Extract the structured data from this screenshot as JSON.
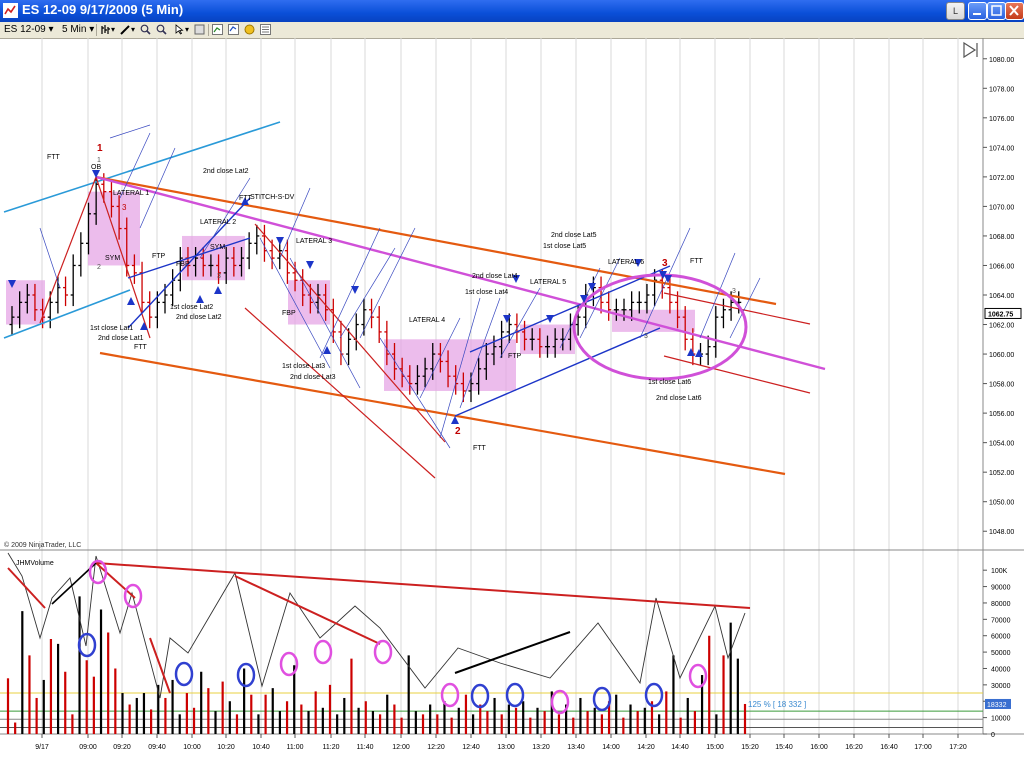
{
  "window": {
    "title": "ES 12-09  9/17/2009 (5 Min)",
    "minimize_label": "L"
  },
  "toolbar": {
    "instrument": "ES 12-09",
    "interval": "5 Min"
  },
  "copyright": "© 2009 NinjaTrader, LLC",
  "colors": {
    "up_bar": "#000000",
    "down_bar": "#cc0000",
    "lateral_box": "#e6a6e6",
    "channel_red": "#cc2020",
    "channel_orange": "#e45a10",
    "trend_blue": "#1c35c8",
    "cyan_line": "#2a9ad8",
    "magenta_line": "#d050d8"
  },
  "chart_data": [
    {
      "type": "bar",
      "panel": "price",
      "title": "",
      "ylim": [
        1047,
        1081
      ],
      "y_ticks": [
        "1080.00",
        "1078.00",
        "1076.00",
        "1074.00",
        "1072.00",
        "1070.00",
        "1068.00",
        "1066.00",
        "1064.00",
        "1062.00",
        "1060.00",
        "1058.00",
        "1056.00",
        "1054.00",
        "1052.00",
        "1050.00",
        "1048.00"
      ],
      "last_price": "1062.75",
      "x_ticks": [
        "9/17",
        "09:00",
        "09:20",
        "09:40",
        "10:00",
        "10:20",
        "10:40",
        "11:00",
        "11:20",
        "11:40",
        "12:00",
        "12:20",
        "12:40",
        "13:00",
        "13:20",
        "13:40",
        "14:00",
        "14:20",
        "14:40",
        "15:00",
        "15:20",
        "15:40",
        "16:00",
        "16:20",
        "16:40",
        "17:00",
        "17:20"
      ],
      "close_series": [
        1062.5,
        1063.5,
        1064,
        1063,
        1062.5,
        1063.5,
        1064.5,
        1064,
        1066,
        1067.5,
        1069.5,
        1071.5,
        1071,
        1070,
        1068.5,
        1066,
        1065.5,
        1063.5,
        1062.5,
        1063.5,
        1064,
        1065,
        1066.5,
        1066,
        1066.5,
        1066,
        1066,
        1065.5,
        1066.5,
        1066,
        1066.5,
        1067.5,
        1068,
        1067,
        1066.5,
        1067,
        1065.5,
        1065,
        1064,
        1063.5,
        1064,
        1063,
        1061.5,
        1060,
        1061,
        1062,
        1063,
        1062.5,
        1061.5,
        1060,
        1059,
        1058.5,
        1058,
        1058.5,
        1059,
        1060,
        1059.5,
        1058.5,
        1058,
        1057.5,
        1058,
        1059,
        1060,
        1060.5,
        1061.5,
        1062,
        1061.5,
        1061,
        1061,
        1060.5,
        1060.5,
        1061,
        1061,
        1062,
        1062.5,
        1064,
        1064.5,
        1063.5,
        1063,
        1063,
        1063,
        1063.5,
        1063.5,
        1064,
        1065,
        1064.5,
        1063.5,
        1062.5,
        1061,
        1060,
        1060,
        1060.5,
        1062.5,
        1063,
        1063.5,
        1063.5
      ],
      "annotations": [
        "1",
        "1",
        "3",
        "2",
        "2",
        "3",
        "3",
        "3",
        "3",
        "FTT",
        "OB",
        "LATERAL 1",
        "LATERAL 2",
        "LATERAL 3",
        "LATERAL 4",
        "LATERAL 5",
        "LATERAL 6",
        "LATERAL 6",
        "FTP",
        "FBP",
        "SYM",
        "SYM",
        "2nd close Lat2",
        "STITCH-S-DV",
        "1st close Lat1",
        "2nd close Lat1",
        "1st close Lat2",
        "2nd close Lat2",
        "1st close Lat3",
        "2nd close Lat3",
        "2nd close Lat4",
        "1st close Lat4",
        "2nd close Lat5",
        "1st close Lat5",
        "1st close Lat6",
        "2nd close Lat6"
      ]
    },
    {
      "type": "bar",
      "panel": "volume",
      "series_name": "JHMVolume",
      "ylim": [
        0,
        105000
      ],
      "y_ticks": [
        "100K",
        "90000",
        "80000",
        "70000",
        "60000",
        "50000",
        "40000",
        "30000",
        "20000",
        "10000",
        "0"
      ],
      "last_volume": "18332",
      "readout": "125 % [ 18 332 ]",
      "values": [
        34000,
        7000,
        75000,
        48000,
        22000,
        33000,
        58000,
        55000,
        38000,
        12000,
        84000,
        45000,
        35000,
        76000,
        62000,
        40000,
        25000,
        18000,
        22000,
        25000,
        15000,
        30000,
        22000,
        33000,
        12000,
        25000,
        16000,
        38000,
        28000,
        14000,
        32000,
        20000,
        12000,
        40000,
        24000,
        12000,
        24000,
        28000,
        14000,
        20000,
        42000,
        18000,
        14000,
        26000,
        16000,
        30000,
        12000,
        22000,
        46000,
        16000,
        20000,
        14000,
        12000,
        24000,
        18000,
        10000,
        48000,
        14000,
        12000,
        18000,
        12000,
        20000,
        10000,
        16000,
        24000,
        12000,
        18000,
        14000,
        22000,
        12000,
        18000,
        16000,
        20000,
        10000,
        16000,
        14000,
        26000,
        12000,
        18000,
        10000,
        22000,
        14000,
        16000,
        12000,
        20000,
        24000,
        10000,
        18000,
        14000,
        16000,
        20000,
        12000,
        26000,
        48000,
        10000,
        22000,
        14000,
        36000,
        60000,
        12000,
        48000,
        68000,
        46000,
        18332
      ],
      "colors_up": [
        0,
        0,
        1,
        0,
        0,
        1,
        0,
        1,
        0,
        0,
        1,
        0,
        0,
        1,
        0,
        0,
        1,
        0,
        1,
        1,
        0,
        1,
        0,
        1,
        1,
        0,
        0,
        1,
        0,
        1,
        0,
        1,
        0,
        1,
        0,
        1,
        0,
        1,
        1,
        0,
        1,
        0,
        1,
        0,
        1,
        0,
        1,
        1,
        0,
        1,
        0,
        1,
        0,
        1,
        0,
        0,
        1,
        1,
        0,
        1,
        0,
        1,
        0,
        1,
        0,
        1,
        0,
        0,
        1,
        0,
        1,
        0,
        1,
        0,
        1,
        0,
        1,
        0,
        1,
        0,
        1,
        0,
        1,
        0,
        0,
        1,
        0,
        1,
        0,
        1,
        0,
        1,
        0,
        1,
        0,
        1,
        0,
        1,
        0,
        1,
        0,
        1,
        1,
        0
      ]
    }
  ]
}
